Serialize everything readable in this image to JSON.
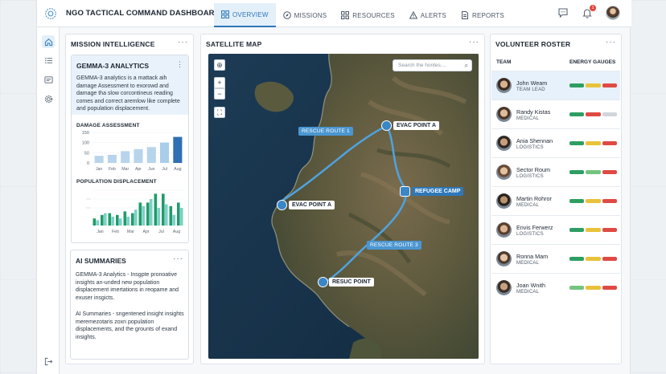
{
  "app": {
    "title": "NGO TACTICAL COMMAND DASHBOARD"
  },
  "nav": [
    {
      "label": "OVERVIEW",
      "icon": "grid-icon",
      "active": true
    },
    {
      "label": "MISSIONS",
      "icon": "compass-icon",
      "active": false
    },
    {
      "label": "RESOURCES",
      "icon": "apps-icon",
      "active": false
    },
    {
      "label": "ALERTS",
      "icon": "warning-icon",
      "active": false
    },
    {
      "label": "REPORTS",
      "icon": "document-icon",
      "active": false
    }
  ],
  "notifications": {
    "count": "1"
  },
  "mission_intel": {
    "title": "MISSION INTELLIGENCE",
    "menu": "···",
    "analytics": {
      "title": "GEMMA-3 ANALYTICS",
      "menu": "⋮",
      "text": "GEMMA-3 analytics is a mattack aih damage Assessment to exorowd and damage tha slow corcontineus reading comes and correct aremlow like complete and population displacement."
    },
    "damage_chart": {
      "label": "DAMAGE ASSESSMENT",
      "ticks": [
        "150",
        "100",
        "50",
        "0"
      ]
    },
    "population_chart": {
      "label": "POPULATION DISPLACEMENT"
    }
  },
  "ai_summaries": {
    "title": "AI SUMMARIES",
    "menu": "···",
    "para1": "GEMMA-3 Analytics - Insgpte pronoative insights an-unded new population displacement imertations in reopame and exuser insgicts.",
    "para2": "AI Summaries - sngentened insight insights meremezotaris zoxn population displacements, and the grounts of exand insights."
  },
  "map": {
    "title": "SATELLITE MAP",
    "menu": "···",
    "search_placeholder": "Search the hontes....",
    "points": [
      {
        "label": "EVAC POINT A"
      },
      {
        "label": "EVAC POINT A"
      },
      {
        "label": "REFUGEE CAMP"
      },
      {
        "label": "RESUC POINT"
      }
    ],
    "routes": [
      {
        "label": "RESCUE ROUTE 1"
      },
      {
        "label": "RESCUE ROUTE 3"
      }
    ]
  },
  "roster": {
    "title": "VOLUNTEER ROSTER",
    "menu": "···",
    "col_team": "TEAM",
    "col_gauges": "ENERGY GAUGES",
    "colors": {
      "green": "#2e9e63",
      "yellow": "#e8c23a",
      "red": "#df4a44",
      "lightgreen": "#74c47e",
      "gray": "#cfd5db"
    },
    "volunteers": [
      {
        "name": "John Weam",
        "role": "TEAM LEAD",
        "gauge": [
          "green",
          "yellow",
          "red"
        ]
      },
      {
        "name": "Randy Kistas",
        "role": "MEDICAL",
        "gauge": [
          "green",
          "red",
          "gray"
        ]
      },
      {
        "name": "Ania Shennan",
        "role": "LOGISTICS",
        "gauge": [
          "green",
          "yellow",
          "red"
        ]
      },
      {
        "name": "Sector Roum",
        "role": "LOGISTICS",
        "gauge": [
          "green",
          "lightgreen",
          "red"
        ]
      },
      {
        "name": "Martin Rohror",
        "role": "MEDICAL",
        "gauge": [
          "green",
          "yellow",
          "red"
        ]
      },
      {
        "name": "Envis Ferwerz",
        "role": "LOGISTICS",
        "gauge": [
          "green",
          "yellow",
          "red"
        ]
      },
      {
        "name": "Ronna Mam",
        "role": "MEDICAL",
        "gauge": [
          "green",
          "yellow",
          "red"
        ]
      },
      {
        "name": "Joan Wnith",
        "role": "MEDICAL",
        "gauge": [
          "lightgreen",
          "yellow",
          "red"
        ]
      }
    ]
  },
  "chart_data": [
    {
      "type": "bar",
      "title": "DAMAGE ASSESSMENT",
      "categories": [
        "Jan",
        "Feb",
        "Mar",
        "Apr",
        "Jun",
        "Jul",
        "Aug"
      ],
      "values": [
        35,
        40,
        58,
        68,
        78,
        100,
        128
      ],
      "ylim": [
        0,
        150
      ],
      "yticks": [
        0,
        50,
        100,
        150
      ],
      "colors": [
        "#b8d4ec",
        "#b8d4ec",
        "#b8d4ec",
        "#b8d4ec",
        "#b8d4ec",
        "#a9cdea",
        "#2f6fb3"
      ]
    },
    {
      "type": "bar",
      "title": "POPULATION DISPLACEMENT",
      "categories": [
        "Jan",
        "Feb",
        "Mar",
        "Apr",
        "Jul",
        "Aug"
      ],
      "series": [
        {
          "values": [
            8,
            12,
            14,
            12,
            16,
            14,
            26,
            26,
            36,
            36,
            22,
            26
          ]
        },
        {
          "values": [
            6,
            14,
            10,
            8,
            10,
            18,
            22,
            30,
            20,
            24,
            12,
            20
          ]
        }
      ],
      "colors": [
        "#1f9c6a",
        "#7fd0c8"
      ]
    }
  ]
}
